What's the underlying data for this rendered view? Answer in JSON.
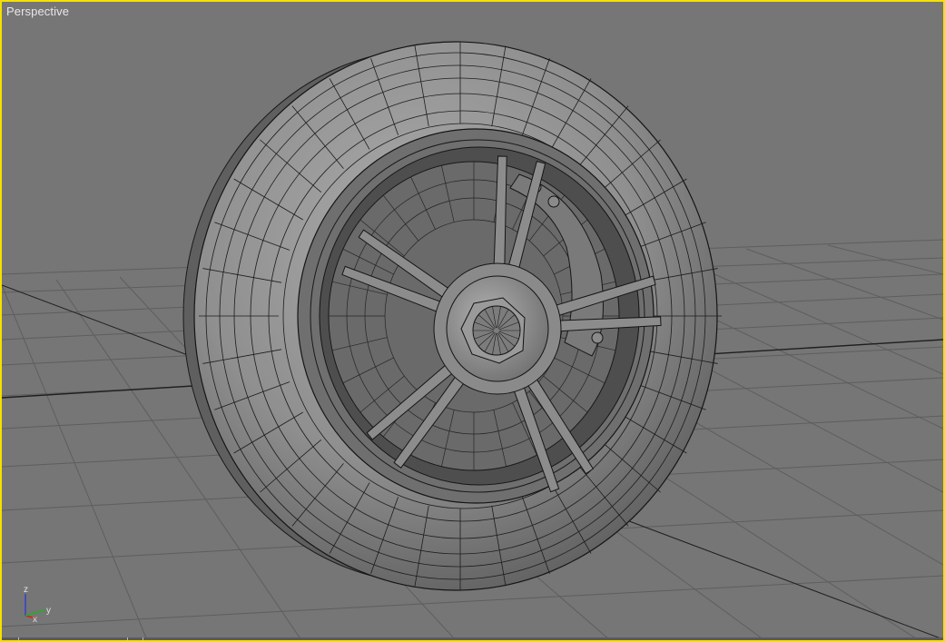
{
  "viewport": {
    "label": "Perspective",
    "active_border_color": "#f5e000",
    "background_color": "#767676",
    "grid_color": "#5c5c5c",
    "grid_axis_color": "#1a1a1a"
  },
  "scene": {
    "object": "wheel-with-tire",
    "spoke_pairs": 5,
    "wireframe_on_shaded": true
  },
  "axis_gizmo": {
    "z_label": "z",
    "x_label": "x",
    "y_label": "y",
    "z_color": "#3040d0",
    "x_color": "#d02020",
    "y_color": "#20b020"
  }
}
